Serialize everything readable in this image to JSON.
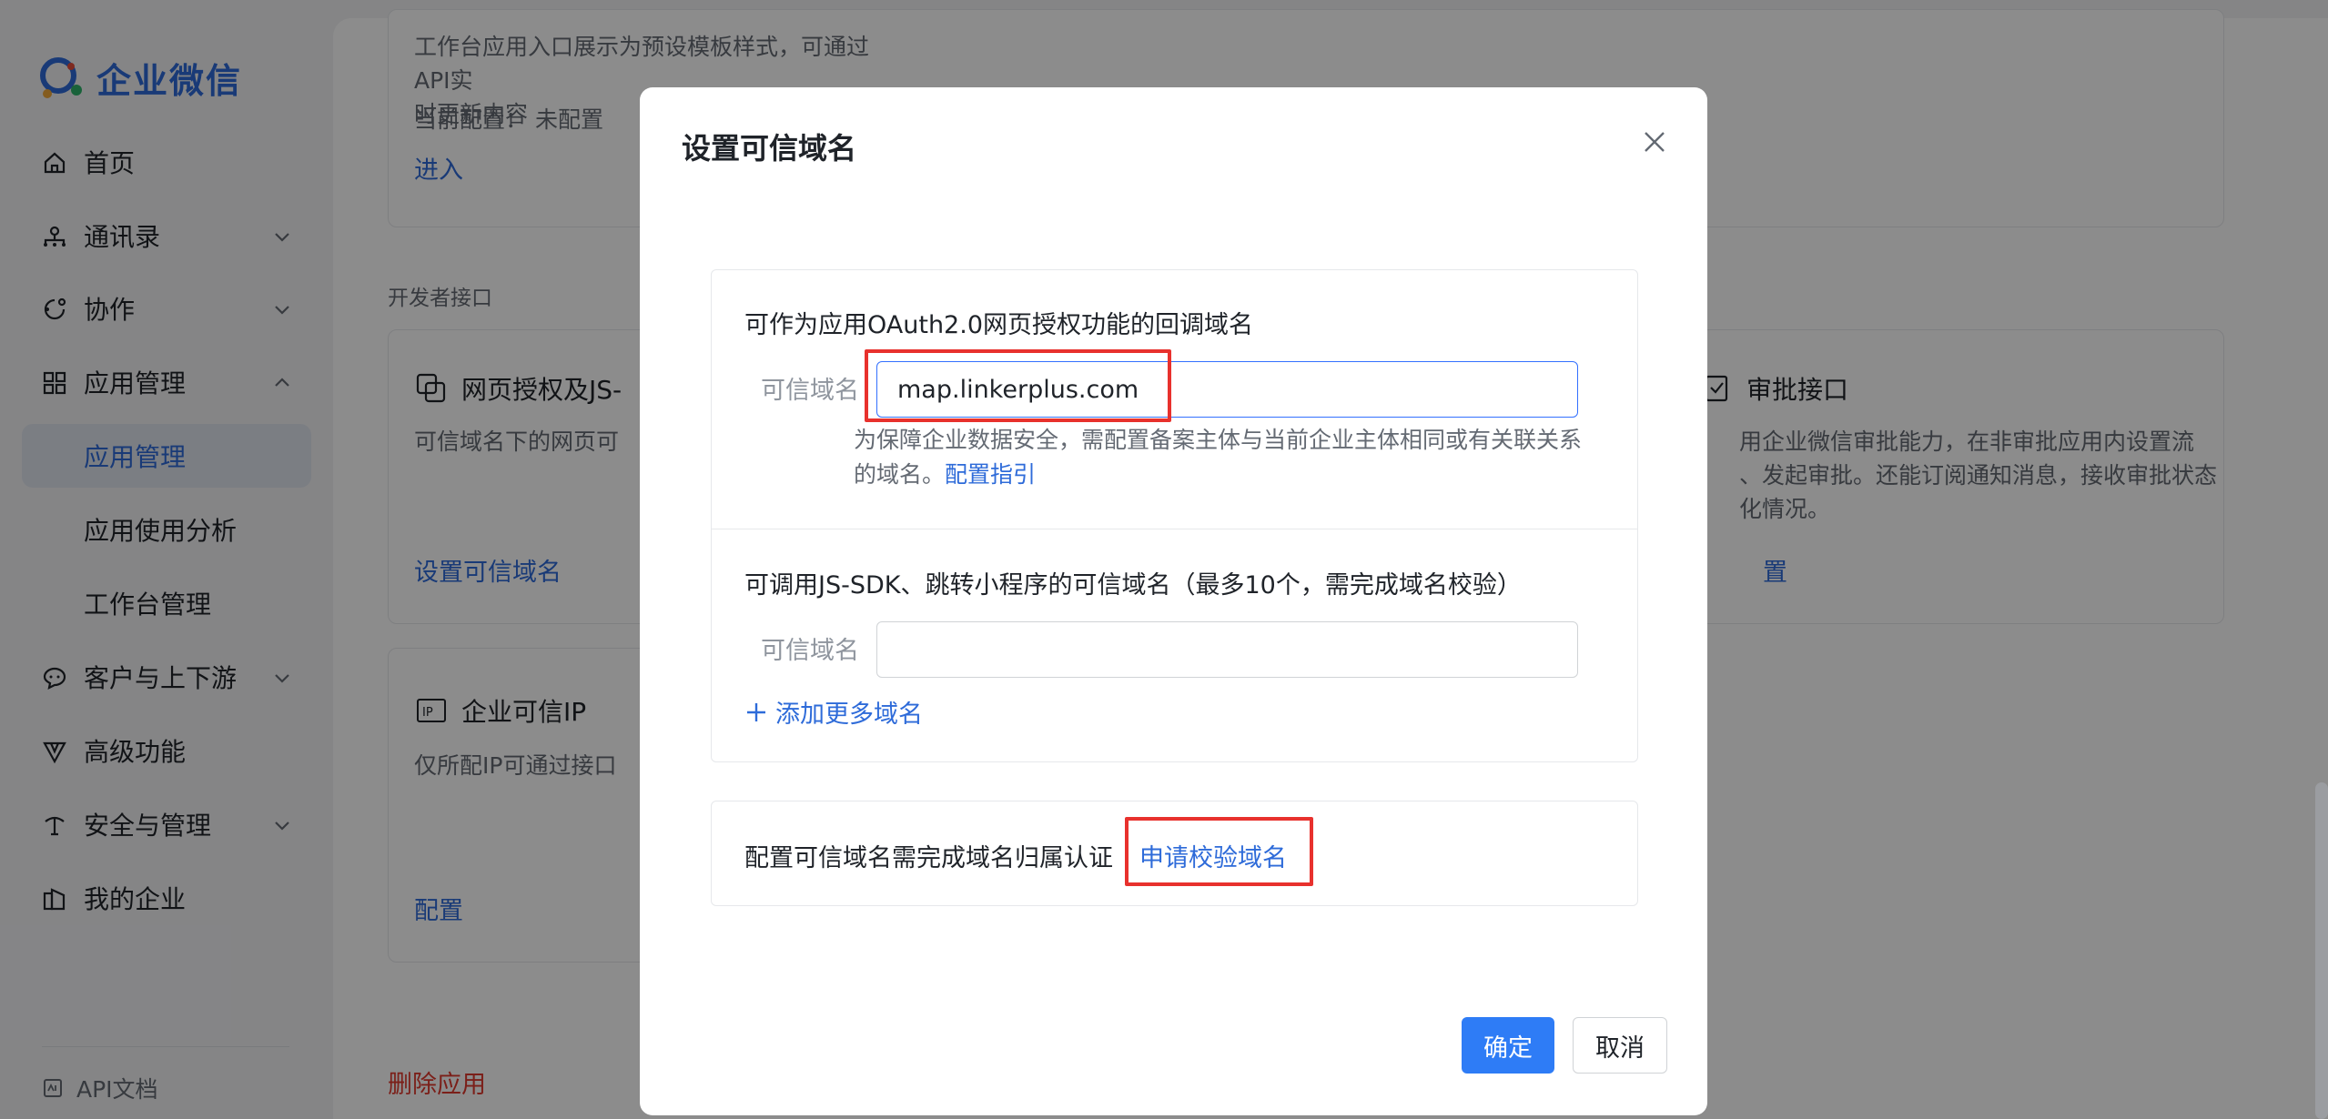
{
  "sidebar": {
    "logo_text": "企业微信",
    "items": [
      {
        "label": "首页",
        "icon": "home-icon"
      },
      {
        "label": "通讯录",
        "icon": "contacts-icon"
      },
      {
        "label": "协作",
        "icon": "collaboration-icon"
      },
      {
        "label": "应用管理",
        "icon": "apps-icon"
      },
      {
        "label": "应用管理"
      },
      {
        "label": "应用使用分析"
      },
      {
        "label": "工作台管理"
      },
      {
        "label": "客户与上下游",
        "icon": "chat-icon"
      },
      {
        "label": "高级功能",
        "icon": "advanced-icon"
      },
      {
        "label": "安全与管理",
        "icon": "security-icon"
      },
      {
        "label": "我的企业",
        "icon": "company-icon"
      }
    ],
    "api_doc": "API文档"
  },
  "background": {
    "workbench_desc_line1": "工作台应用入口展示为预设模板样式，可通过API实",
    "workbench_desc_line2": "时更新内容",
    "current_config": "当前配置：  未配置",
    "enter": "进入",
    "developer_section": "开发者接口",
    "web_auth_title": "网页授权及JS-",
    "web_auth_desc": "可信域名下的网页可",
    "web_auth_link": "设置可信域名",
    "approval_title": "审批接口",
    "approval_desc_line1": "用企业微信审批能力，在非审批应用内设置流",
    "approval_desc_line2": "、发起审批。还能订阅通知消息，接收审批状态",
    "approval_desc_line3": "化情况。",
    "approval_link": "置",
    "ip_title": "企业可信IP",
    "ip_desc": "仅所配IP可通过接口",
    "ip_link": "配置",
    "delete_app": "删除应用"
  },
  "modal": {
    "title": "设置可信域名",
    "oauth_heading": "可作为应用OAuth2.0网页授权功能的回调域名",
    "domain_label": "可信域名",
    "oauth_value": "map.linkerplus.com",
    "oauth_note_line1": "为保障企业数据安全，需配置备案主体与当前企业主体相同或有关联关系",
    "oauth_note_line2_prefix": "的域名。",
    "oauth_note_link": "配置指引",
    "jssdk_heading": "可调用JS-SDK、跳转小程序的可信域名（最多10个，需完成域名校验）",
    "jssdk_label": "可信域名",
    "jssdk_value": "",
    "add_more": "添加更多域名",
    "verify_text": "配置可信域名需完成域名归属认证",
    "verify_link": "申请校验域名",
    "confirm": "确定",
    "cancel": "取消"
  },
  "colors": {
    "accent": "#2e6bd9",
    "primary_button": "#2e7cf6",
    "highlight": "#e8312d",
    "danger": "#e03a2f"
  }
}
